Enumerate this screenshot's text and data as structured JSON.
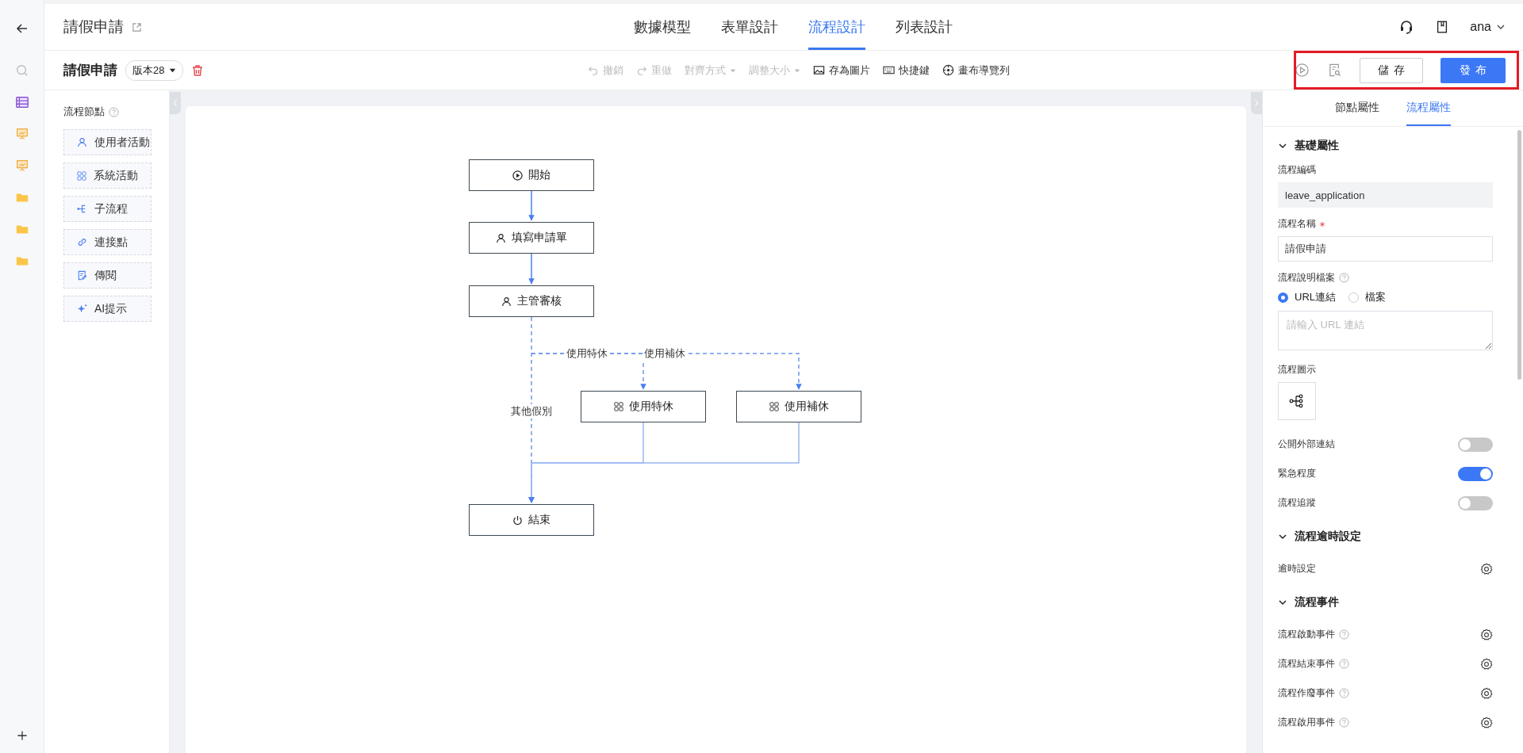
{
  "header": {
    "title": "請假申請",
    "tabs": [
      {
        "label": "數據模型",
        "selected": false
      },
      {
        "label": "表單設計",
        "selected": false
      },
      {
        "label": "流程設計",
        "selected": true
      },
      {
        "label": "列表設計",
        "selected": false
      }
    ],
    "user": "ana"
  },
  "toolbar": {
    "title": "請假申請",
    "version": "版本28",
    "actions": [
      {
        "kind": "undo",
        "label": "撤銷",
        "disabled": true,
        "dropdown": false
      },
      {
        "kind": "redo",
        "label": "重做",
        "disabled": true,
        "dropdown": false
      },
      {
        "kind": "align",
        "label": "對齊方式",
        "disabled": true,
        "dropdown": true
      },
      {
        "kind": "resize",
        "label": "調整大小",
        "disabled": true,
        "dropdown": true
      },
      {
        "kind": "image",
        "label": "存為圖片",
        "disabled": false,
        "dropdown": false
      },
      {
        "kind": "keyboard",
        "label": "快捷鍵",
        "disabled": false,
        "dropdown": false
      },
      {
        "kind": "navigator",
        "label": "畫布導覽列",
        "disabled": false,
        "dropdown": false
      }
    ],
    "save": "儲存",
    "publish": "發布"
  },
  "palette": {
    "title": "流程節點",
    "items": [
      {
        "kind": "user",
        "label": "使用者活動"
      },
      {
        "kind": "system",
        "label": "系統活動"
      },
      {
        "kind": "subprocess",
        "label": "子流程"
      },
      {
        "kind": "link",
        "label": "連接點"
      },
      {
        "kind": "cc",
        "label": "傳閱"
      },
      {
        "kind": "ai",
        "label": "AI提示"
      }
    ]
  },
  "diagram": {
    "nodes": [
      {
        "kind": "start",
        "label": "開始"
      },
      {
        "kind": "user",
        "label": "填寫申請單"
      },
      {
        "kind": "user",
        "label": "主管審核"
      },
      {
        "kind": "system",
        "label": "使用特休"
      },
      {
        "kind": "system",
        "label": "使用補休"
      },
      {
        "kind": "end",
        "label": "結束"
      }
    ],
    "edges": [
      {
        "kind": "solid"
      },
      {
        "kind": "solid"
      },
      {
        "kind": "dashed",
        "label": "使用特休"
      },
      {
        "kind": "dashed",
        "label": "使用補休"
      },
      {
        "kind": "dashed",
        "label": "其他假別"
      },
      {
        "kind": "solid"
      },
      {
        "kind": "solid"
      }
    ]
  },
  "properties": {
    "tabs": [
      {
        "label": "節點屬性",
        "selected": false
      },
      {
        "label": "流程屬性",
        "selected": true
      }
    ],
    "sections": [
      {
        "title": "基礎屬性",
        "expanded": true,
        "fields": [
          {
            "kind": "readonly",
            "label": "流程編碼",
            "value": "leave_application"
          },
          {
            "kind": "input",
            "label": "流程名稱",
            "required": true,
            "value": "請假申請"
          },
          {
            "kind": "doc",
            "label": "流程說明檔案",
            "help": true,
            "options": [
              {
                "label": "URL連結",
                "selected": true
              },
              {
                "label": "檔案",
                "selected": false
              }
            ],
            "placeholder": "請輸入 URL 連結"
          },
          {
            "kind": "icon",
            "label": "流程圖示"
          },
          {
            "kind": "toggle",
            "label": "公開外部連結",
            "on": false
          },
          {
            "kind": "toggle",
            "label": "緊急程度",
            "on": true
          },
          {
            "kind": "toggle",
            "label": "流程追蹤",
            "on": false
          }
        ]
      },
      {
        "title": "流程逾時設定",
        "expanded": true,
        "fields": [
          {
            "kind": "setting",
            "label": "逾時設定",
            "help": false
          }
        ]
      },
      {
        "title": "流程事件",
        "expanded": true,
        "fields": [
          {
            "kind": "setting",
            "label": "流程啟動事件",
            "help": true
          },
          {
            "kind": "setting",
            "label": "流程結束事件",
            "help": true
          },
          {
            "kind": "setting",
            "label": "流程作廢事件",
            "help": true
          },
          {
            "kind": "setting",
            "label": "流程啟用事件",
            "help": true
          }
        ]
      }
    ]
  }
}
